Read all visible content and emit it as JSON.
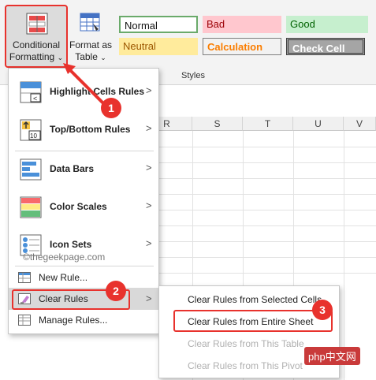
{
  "ribbon": {
    "conditional_formatting": {
      "line1": "Conditional",
      "line2": "Formatting",
      "caret": "⌄"
    },
    "format_as_table": {
      "line1": "Format as",
      "line2": "Table",
      "caret": "⌄"
    },
    "styles": {
      "normal": "Normal",
      "bad": "Bad",
      "good": "Good",
      "neutral": "Neutral",
      "calculation": "Calculation",
      "check_cell": "Check Cell"
    },
    "styles_group_label": "Styles"
  },
  "sheet": {
    "column_headers": [
      "R",
      "S",
      "T",
      "U",
      "V"
    ]
  },
  "dropdown": {
    "items": [
      {
        "label": "Highlight Cells Rules",
        "icon": "highlight-cells-icon",
        "arrow": ">"
      },
      {
        "label": "Top/Bottom Rules",
        "icon": "top-bottom-icon",
        "arrow": ">"
      },
      {
        "label": "Data Bars",
        "icon": "data-bars-icon",
        "arrow": ">"
      },
      {
        "label": "Color Scales",
        "icon": "color-scales-icon",
        "arrow": ">"
      },
      {
        "label": "Icon Sets",
        "icon": "icon-sets-icon",
        "arrow": ">"
      }
    ],
    "new_rule": "New Rule...",
    "clear_rules": "Clear Rules",
    "clear_rules_arrow": ">",
    "manage_rules": "Manage Rules..."
  },
  "watermark": "©thegeekpage.com",
  "submenu": {
    "items": [
      {
        "label": "Clear Rules from Selected Cells",
        "enabled": true
      },
      {
        "label": "Clear Rules from Entire Sheet",
        "enabled": true
      },
      {
        "label": "Clear Rules from This Table",
        "enabled": false
      },
      {
        "label": "Clear Rules from This Pivot",
        "enabled": false
      }
    ]
  },
  "callouts": [
    "1",
    "2",
    "3"
  ],
  "brand": {
    "name": "php",
    "cn": "中文网"
  },
  "colors": {
    "accent_red": "#e8322d",
    "bad_fill": "#ffc7ce",
    "good_fill": "#c6efce",
    "neutral_fill": "#ffeb9c"
  }
}
